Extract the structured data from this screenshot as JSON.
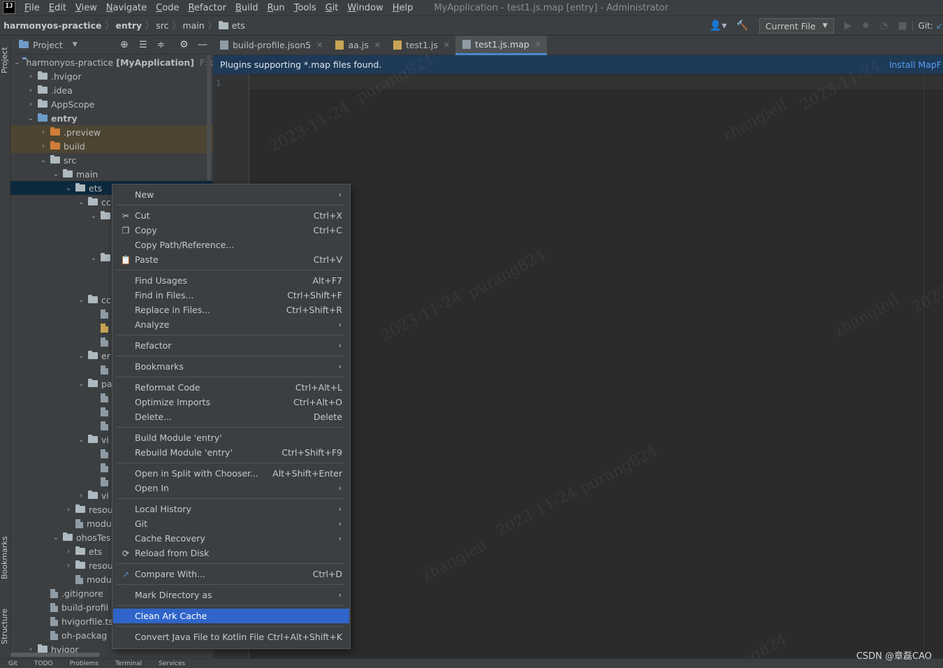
{
  "menubar": {
    "logo": "IJ",
    "items": [
      "File",
      "Edit",
      "View",
      "Navigate",
      "Code",
      "Refactor",
      "Build",
      "Run",
      "Tools",
      "Git",
      "Window",
      "Help"
    ],
    "window_title": "MyApplication - test1.js.map [entry] - Administrator"
  },
  "breadcrumb": {
    "project": "harmonyos-practice",
    "items": [
      "entry",
      "src",
      "main",
      "ets"
    ]
  },
  "toolbar": {
    "run_config": "Current File",
    "git_label": "Git:"
  },
  "project_panel": {
    "title": "Project",
    "root_name": "harmonyos-practice",
    "root_module": "[MyApplication]",
    "root_path": "F:\\c",
    "rows": [
      {
        "label": ".hvigor",
        "depth": 1,
        "chev": "›",
        "icon": "folder"
      },
      {
        "label": ".idea",
        "depth": 1,
        "chev": "›",
        "icon": "folder"
      },
      {
        "label": "AppScope",
        "depth": 1,
        "chev": "›",
        "icon": "folder"
      },
      {
        "label": "entry",
        "depth": 1,
        "chev": "⌄",
        "icon": "folder-blue",
        "bold": true
      },
      {
        "label": ".preview",
        "depth": 2,
        "chev": "›",
        "icon": "folder-orange",
        "hl": true
      },
      {
        "label": "build",
        "depth": 2,
        "chev": "›",
        "icon": "folder-orange",
        "hl": true
      },
      {
        "label": "src",
        "depth": 2,
        "chev": "⌄",
        "icon": "folder"
      },
      {
        "label": "main",
        "depth": 3,
        "chev": "⌄",
        "icon": "folder"
      },
      {
        "label": "ets",
        "depth": 4,
        "chev": "⌄",
        "icon": "folder",
        "sel": true
      },
      {
        "label": "cc",
        "depth": 5,
        "chev": "⌄",
        "icon": "folder"
      },
      {
        "label": "",
        "depth": 6,
        "chev": "⌄",
        "icon": "folder"
      },
      {
        "label": "",
        "depth": 7,
        "chev": "",
        "icon": "none"
      },
      {
        "label": "",
        "depth": 7,
        "chev": "",
        "icon": "none"
      },
      {
        "label": "",
        "depth": 6,
        "chev": "⌄",
        "icon": "folder"
      },
      {
        "label": "",
        "depth": 7,
        "chev": "",
        "icon": "none"
      },
      {
        "label": "",
        "depth": 7,
        "chev": "",
        "icon": "none"
      },
      {
        "label": "cc",
        "depth": 5,
        "chev": "⌄",
        "icon": "folder"
      },
      {
        "label": "",
        "depth": 6,
        "chev": "",
        "icon": "file"
      },
      {
        "label": "",
        "depth": 6,
        "chev": "",
        "icon": "file-js"
      },
      {
        "label": "",
        "depth": 6,
        "chev": "",
        "icon": "file"
      },
      {
        "label": "er",
        "depth": 5,
        "chev": "⌄",
        "icon": "folder"
      },
      {
        "label": "",
        "depth": 6,
        "chev": "",
        "icon": "file"
      },
      {
        "label": "pa",
        "depth": 5,
        "chev": "⌄",
        "icon": "folder"
      },
      {
        "label": "",
        "depth": 6,
        "chev": "",
        "icon": "file"
      },
      {
        "label": "",
        "depth": 6,
        "chev": "",
        "icon": "file"
      },
      {
        "label": "",
        "depth": 6,
        "chev": "",
        "icon": "file"
      },
      {
        "label": "vi",
        "depth": 5,
        "chev": "⌄",
        "icon": "folder"
      },
      {
        "label": "",
        "depth": 6,
        "chev": "",
        "icon": "file"
      },
      {
        "label": "",
        "depth": 6,
        "chev": "",
        "icon": "file"
      },
      {
        "label": "",
        "depth": 6,
        "chev": "",
        "icon": "file"
      },
      {
        "label": "vi",
        "depth": 5,
        "chev": "›",
        "icon": "folder"
      },
      {
        "label": "resou",
        "depth": 4,
        "chev": "›",
        "icon": "folder"
      },
      {
        "label": "modu",
        "depth": 4,
        "chev": "",
        "icon": "file"
      },
      {
        "label": "ohosTes",
        "depth": 3,
        "chev": "⌄",
        "icon": "folder"
      },
      {
        "label": "ets",
        "depth": 4,
        "chev": "›",
        "icon": "folder"
      },
      {
        "label": "resou",
        "depth": 4,
        "chev": "›",
        "icon": "folder"
      },
      {
        "label": "modu",
        "depth": 4,
        "chev": "",
        "icon": "file"
      },
      {
        "label": ".gitignore",
        "depth": 2,
        "chev": "",
        "icon": "file"
      },
      {
        "label": "build-profil",
        "depth": 2,
        "chev": "",
        "icon": "file"
      },
      {
        "label": "hvigorfile.ts",
        "depth": 2,
        "chev": "",
        "icon": "file"
      },
      {
        "label": "oh-packag",
        "depth": 2,
        "chev": "",
        "icon": "file"
      },
      {
        "label": "hvigor",
        "depth": 1,
        "chev": "›",
        "icon": "folder"
      }
    ]
  },
  "tabs": [
    {
      "label": "build-profile.json5",
      "icon": "file",
      "active": false
    },
    {
      "label": "aa.js",
      "icon": "file-js",
      "active": false
    },
    {
      "label": "test1.js",
      "icon": "file-js",
      "active": false
    },
    {
      "label": "test1.js.map",
      "icon": "file",
      "active": true
    }
  ],
  "notice": {
    "text": "Plugins supporting *.map files found.",
    "link": "Install MapF"
  },
  "editor": {
    "line_numbers": [
      "1"
    ]
  },
  "side_labels": {
    "project": "Project",
    "bookmarks": "Bookmarks",
    "structure": "Structure"
  },
  "context_menu": {
    "items": [
      {
        "type": "item",
        "label": "New",
        "shortcut": "",
        "submenu": true,
        "icon": ""
      },
      {
        "type": "sep"
      },
      {
        "type": "item",
        "label": "Cut",
        "shortcut": "Ctrl+X",
        "submenu": false,
        "icon": "✂"
      },
      {
        "type": "item",
        "label": "Copy",
        "shortcut": "Ctrl+C",
        "submenu": false,
        "icon": "❐"
      },
      {
        "type": "item",
        "label": "Copy Path/Reference...",
        "shortcut": "",
        "submenu": false,
        "icon": ""
      },
      {
        "type": "item",
        "label": "Paste",
        "shortcut": "Ctrl+V",
        "submenu": false,
        "icon": "📋"
      },
      {
        "type": "sep"
      },
      {
        "type": "item",
        "label": "Find Usages",
        "shortcut": "Alt+F7",
        "submenu": false,
        "icon": ""
      },
      {
        "type": "item",
        "label": "Find in Files...",
        "shortcut": "Ctrl+Shift+F",
        "submenu": false,
        "icon": ""
      },
      {
        "type": "item",
        "label": "Replace in Files...",
        "shortcut": "Ctrl+Shift+R",
        "submenu": false,
        "icon": ""
      },
      {
        "type": "item",
        "label": "Analyze",
        "shortcut": "",
        "submenu": true,
        "icon": ""
      },
      {
        "type": "sep"
      },
      {
        "type": "item",
        "label": "Refactor",
        "shortcut": "",
        "submenu": true,
        "icon": ""
      },
      {
        "type": "sep"
      },
      {
        "type": "item",
        "label": "Bookmarks",
        "shortcut": "",
        "submenu": true,
        "icon": ""
      },
      {
        "type": "sep"
      },
      {
        "type": "item",
        "label": "Reformat Code",
        "shortcut": "Ctrl+Alt+L",
        "submenu": false,
        "icon": ""
      },
      {
        "type": "item",
        "label": "Optimize Imports",
        "shortcut": "Ctrl+Alt+O",
        "submenu": false,
        "icon": ""
      },
      {
        "type": "item",
        "label": "Delete...",
        "shortcut": "Delete",
        "submenu": false,
        "icon": ""
      },
      {
        "type": "sep"
      },
      {
        "type": "item",
        "label": "Build Module 'entry'",
        "shortcut": "",
        "submenu": false,
        "icon": ""
      },
      {
        "type": "item",
        "label": "Rebuild Module 'entry'",
        "shortcut": "Ctrl+Shift+F9",
        "submenu": false,
        "icon": ""
      },
      {
        "type": "sep"
      },
      {
        "type": "item",
        "label": "Open in Split with Chooser...",
        "shortcut": "Alt+Shift+Enter",
        "submenu": false,
        "icon": ""
      },
      {
        "type": "item",
        "label": "Open In",
        "shortcut": "",
        "submenu": true,
        "icon": ""
      },
      {
        "type": "sep"
      },
      {
        "type": "item",
        "label": "Local History",
        "shortcut": "",
        "submenu": true,
        "icon": ""
      },
      {
        "type": "item",
        "label": "Git",
        "shortcut": "",
        "submenu": true,
        "icon": ""
      },
      {
        "type": "item",
        "label": "Cache Recovery",
        "shortcut": "",
        "submenu": true,
        "icon": ""
      },
      {
        "type": "item",
        "label": "Reload from Disk",
        "shortcut": "",
        "submenu": false,
        "icon": "⟳"
      },
      {
        "type": "sep"
      },
      {
        "type": "item",
        "label": "Compare With...",
        "shortcut": "Ctrl+D",
        "submenu": false,
        "icon": "↗"
      },
      {
        "type": "sep"
      },
      {
        "type": "item",
        "label": "Mark Directory as",
        "shortcut": "",
        "submenu": true,
        "icon": ""
      },
      {
        "type": "sep"
      },
      {
        "type": "item",
        "label": "Clean Ark Cache",
        "shortcut": "",
        "submenu": false,
        "icon": "",
        "selected": true
      },
      {
        "type": "sep"
      },
      {
        "type": "item",
        "label": "Convert Java File to Kotlin File",
        "shortcut": "Ctrl+Alt+Shift+K",
        "submenu": false,
        "icon": ""
      }
    ]
  },
  "statusbar": {
    "items": [
      "Git",
      "TODO",
      "Problems",
      "Terminal",
      "Services"
    ]
  },
  "watermarks": [
    "zhangleil",
    "2023-11-24",
    "purang824"
  ],
  "csdn_watermark": "CSDN @章磊CAO",
  "colors": {
    "accent": "#2f65ca",
    "notice_bg": "#1e3a57",
    "link": "#589df6"
  }
}
